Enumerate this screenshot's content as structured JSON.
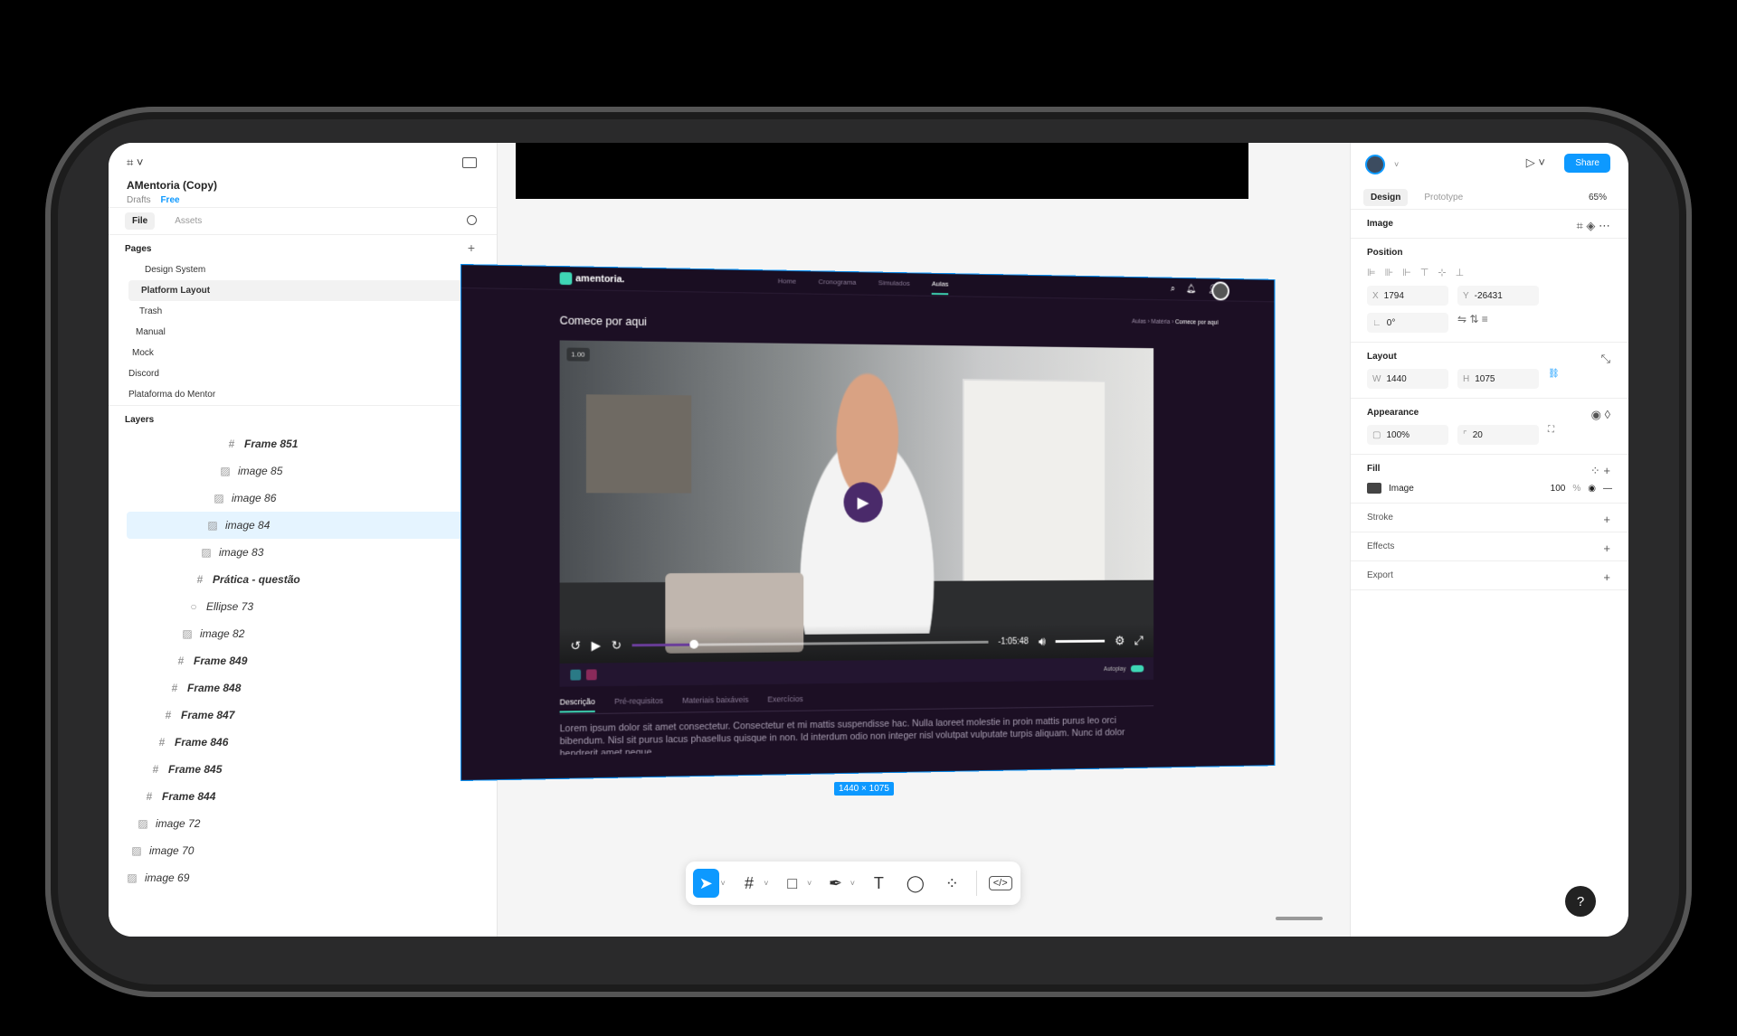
{
  "figma": {
    "file_title": "AMentoria (Copy)",
    "drafts": "Drafts",
    "plan_badge": "Free",
    "tabs": [
      "File",
      "Assets"
    ],
    "pages_header": "Pages",
    "pages": [
      "Design System",
      "Platform Layout",
      "Trash",
      "Manual",
      "Mock",
      "Discord",
      "Plataforma do Mentor"
    ],
    "layers_header": "Layers",
    "layers": [
      {
        "name": "Frame 851",
        "kind": "frame"
      },
      {
        "name": "image 85",
        "kind": "image"
      },
      {
        "name": "image 86",
        "kind": "image"
      },
      {
        "name": "image 84",
        "kind": "image",
        "selected": true
      },
      {
        "name": "image 83",
        "kind": "image"
      },
      {
        "name": "Prática - questão",
        "kind": "frame"
      },
      {
        "name": "Ellipse 73",
        "kind": "ellipse"
      },
      {
        "name": "image 82",
        "kind": "image"
      },
      {
        "name": "Frame 849",
        "kind": "frame"
      },
      {
        "name": "Frame 848",
        "kind": "frame"
      },
      {
        "name": "Frame 847",
        "kind": "frame"
      },
      {
        "name": "Frame 846",
        "kind": "frame"
      },
      {
        "name": "Frame 845",
        "kind": "frame"
      },
      {
        "name": "Frame 844",
        "kind": "frame"
      },
      {
        "name": "image 72",
        "kind": "image"
      },
      {
        "name": "image 70",
        "kind": "image"
      },
      {
        "name": "image 69",
        "kind": "image"
      }
    ],
    "dimension_badge": "1440 × 1075",
    "right": {
      "share": "Share",
      "tabs": [
        "Design",
        "Prototype"
      ],
      "zoom": "65%",
      "selection_type": "Image",
      "position_label": "Position",
      "x_label": "X",
      "x": "1794",
      "y_label": "Y",
      "y": "-26431",
      "rotation": "0°",
      "layout_label": "Layout",
      "w_label": "W",
      "w": "1440",
      "h_label": "H",
      "h": "1075",
      "appearance_label": "Appearance",
      "opacity": "100%",
      "radius": "20",
      "fill_label": "Fill",
      "fill_name": "Image",
      "fill_opacity": "100",
      "fill_unit": "%",
      "stroke_label": "Stroke",
      "effects_label": "Effects",
      "export_label": "Export"
    }
  },
  "design": {
    "brand": "amentoria.",
    "nav": [
      "Home",
      "Cronograma",
      "Simulados",
      "Aulas"
    ],
    "active_nav": "Aulas",
    "title": "Comece por aqui",
    "crumbs": [
      "Aulas",
      "Matéria",
      "Comece por aqui"
    ],
    "speed": "1.00",
    "time_remaining": "-1:05:48",
    "progress": 0.17,
    "autoplay": "Autoplay",
    "tabs": [
      "Descrição",
      "Pré-requisitos",
      "Materiais baixáveis",
      "Exercícios"
    ],
    "lorem": "Lorem ipsum dolor sit amet consectetur. Consectetur et mi mattis suspendisse hac. Nulla laoreet molestie in proin mattis purus leo orci bibendum. Nisl sit purus lacus phasellus quisque in non. Id interdum odio non integer nisl volutpat vulputate turpis aliquam. Nunc id dolor hendrerit amet neque."
  },
  "colors": {
    "accent": "#0d99ff",
    "design_bg": "#1c0f24",
    "design_accent": "#3ed6b5",
    "play": "#4a2a6a"
  }
}
